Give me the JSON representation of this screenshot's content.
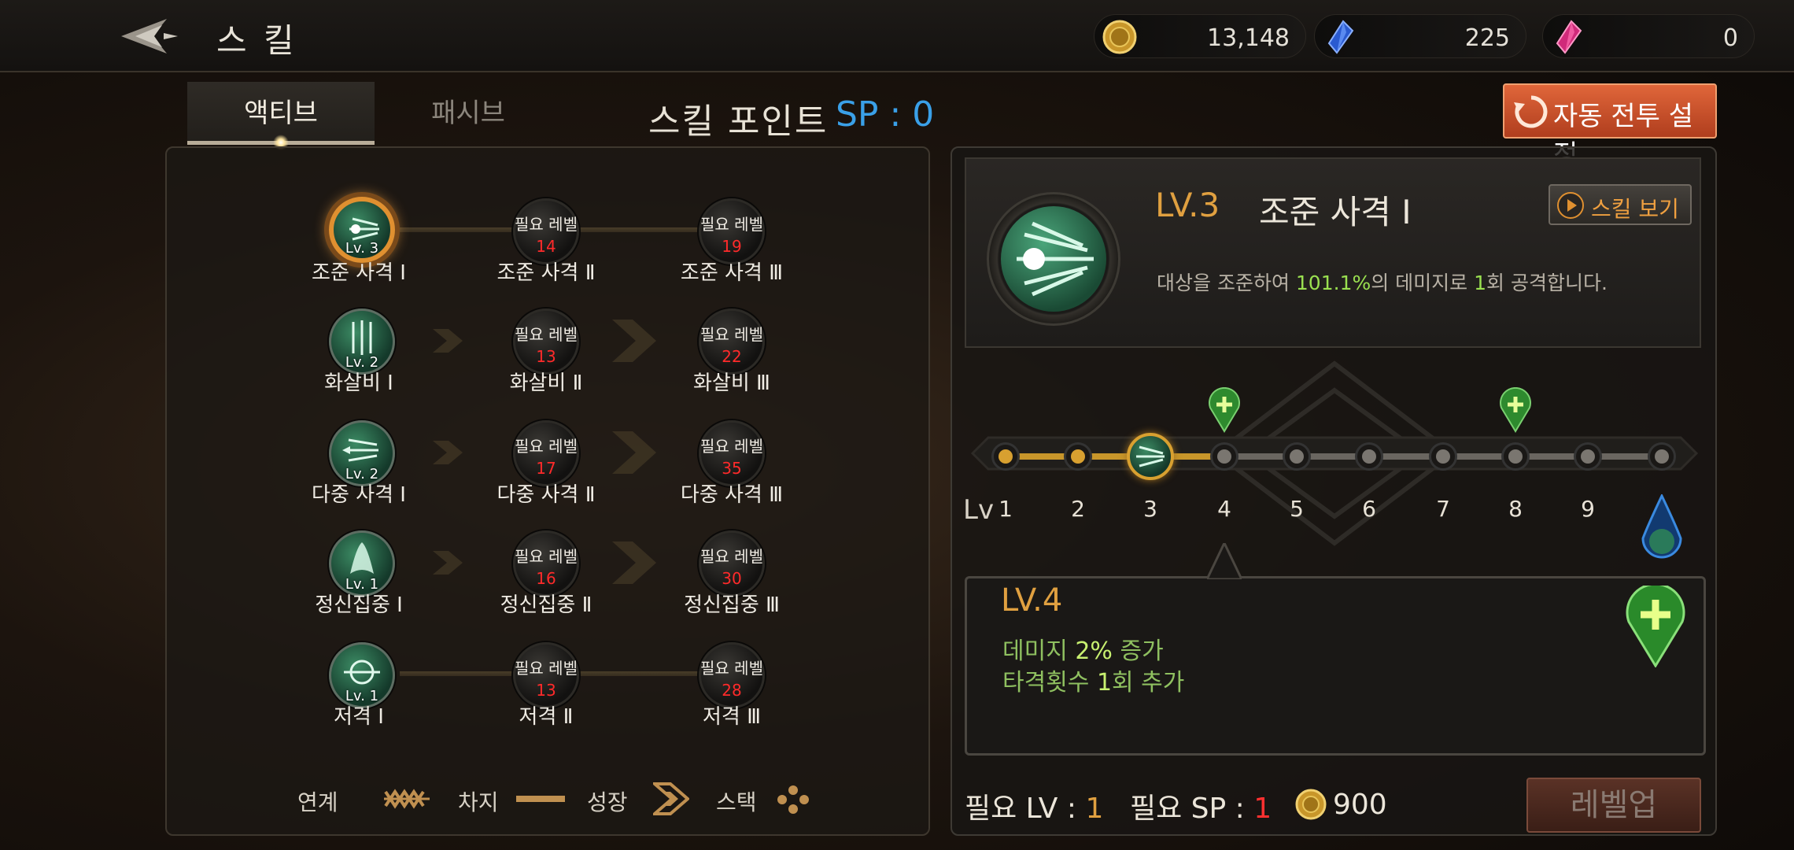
{
  "header": {
    "title": "스 킬",
    "currencies": [
      {
        "icon": "gold-coin-icon",
        "value": "13,148"
      },
      {
        "icon": "blue-crystal-icon",
        "value": "225"
      },
      {
        "icon": "pink-crystal-icon",
        "value": "0"
      }
    ]
  },
  "tabs": [
    {
      "label": "액티브",
      "active": true
    },
    {
      "label": "패시브",
      "active": false
    }
  ],
  "skill_points": {
    "label": "스킬 포인트",
    "value": "SP : 0"
  },
  "auto_battle_button": "자동 전투 설정",
  "skill_tree": {
    "rows": [
      {
        "connector": "chain",
        "skills": [
          {
            "name": "조준 사격 Ⅰ",
            "level_label": "Lv. 3",
            "owned": true,
            "selected": true
          },
          {
            "name": "조준 사격 Ⅱ",
            "req_label": "필요 레벨",
            "req_level": "14"
          },
          {
            "name": "조준 사격 Ⅲ",
            "req_label": "필요 레벨",
            "req_level": "19"
          }
        ]
      },
      {
        "connector": "growth",
        "skills": [
          {
            "name": "화살비 Ⅰ",
            "level_label": "Lv. 2",
            "owned": true
          },
          {
            "name": "화살비 Ⅱ",
            "req_label": "필요 레벨",
            "req_level": "13"
          },
          {
            "name": "화살비 Ⅲ",
            "req_label": "필요 레벨",
            "req_level": "22"
          }
        ]
      },
      {
        "connector": "growth",
        "skills": [
          {
            "name": "다중 사격 Ⅰ",
            "level_label": "Lv. 2",
            "owned": true
          },
          {
            "name": "다중 사격 Ⅱ",
            "req_label": "필요 레벨",
            "req_level": "17"
          },
          {
            "name": "다중 사격 Ⅲ",
            "req_label": "필요 레벨",
            "req_level": "35"
          }
        ]
      },
      {
        "connector": "growth",
        "skills": [
          {
            "name": "정신집중 Ⅰ",
            "level_label": "Lv. 1",
            "owned": true
          },
          {
            "name": "정신집중 Ⅱ",
            "req_label": "필요 레벨",
            "req_level": "16"
          },
          {
            "name": "정신집중 Ⅲ",
            "req_label": "필요 레벨",
            "req_level": "30"
          }
        ]
      },
      {
        "connector": "chain",
        "skills": [
          {
            "name": "저격 Ⅰ",
            "level_label": "Lv. 1",
            "owned": true
          },
          {
            "name": "저격 Ⅱ",
            "req_label": "필요 레벨",
            "req_level": "13"
          },
          {
            "name": "저격 Ⅲ",
            "req_label": "필요 레벨",
            "req_level": "28"
          }
        ]
      }
    ]
  },
  "legend": [
    {
      "label": "연계",
      "icon": "chain-link-icon"
    },
    {
      "label": "차지",
      "icon": "charge-bar-icon"
    },
    {
      "label": "성장",
      "icon": "growth-chevron-icon"
    },
    {
      "label": "스택",
      "icon": "stack-dots-icon"
    }
  ],
  "detail": {
    "level": "LV.3",
    "name": "조준 사격 Ⅰ",
    "view_button": "스킬 보기",
    "desc_prefix": "대상을 조준하여 ",
    "desc_percent": "101.1%",
    "desc_mid": "의 데미지로 ",
    "desc_count": "1",
    "desc_suffix": "회 공격합니다."
  },
  "level_track": {
    "prefix": "Lv",
    "levels": [
      "1",
      "2",
      "3",
      "4",
      "5",
      "6",
      "7",
      "8",
      "9"
    ],
    "current_level": 3,
    "bonus_levels": [
      4,
      8
    ],
    "max_icon": "blue-drop-skill-icon"
  },
  "next_level": {
    "title": "LV.4",
    "line1_prefix": "데미지 ",
    "line1_num": "2%",
    "line1_suffix": " 증가",
    "line2_prefix": "타격횟수 ",
    "line2_num": "1",
    "line2_suffix": "회 추가"
  },
  "requirements": {
    "lv_label": "필요 LV : ",
    "lv_value": "1",
    "sp_label": "필요 SP : ",
    "sp_value": "1",
    "gold_cost": "900"
  },
  "levelup_button": "레벨업",
  "colors": {
    "accent_orange": "#e0a040",
    "sp_blue": "#3aa0e8",
    "req_red": "#ff2a2a",
    "bonus_green": "#9ae050"
  }
}
